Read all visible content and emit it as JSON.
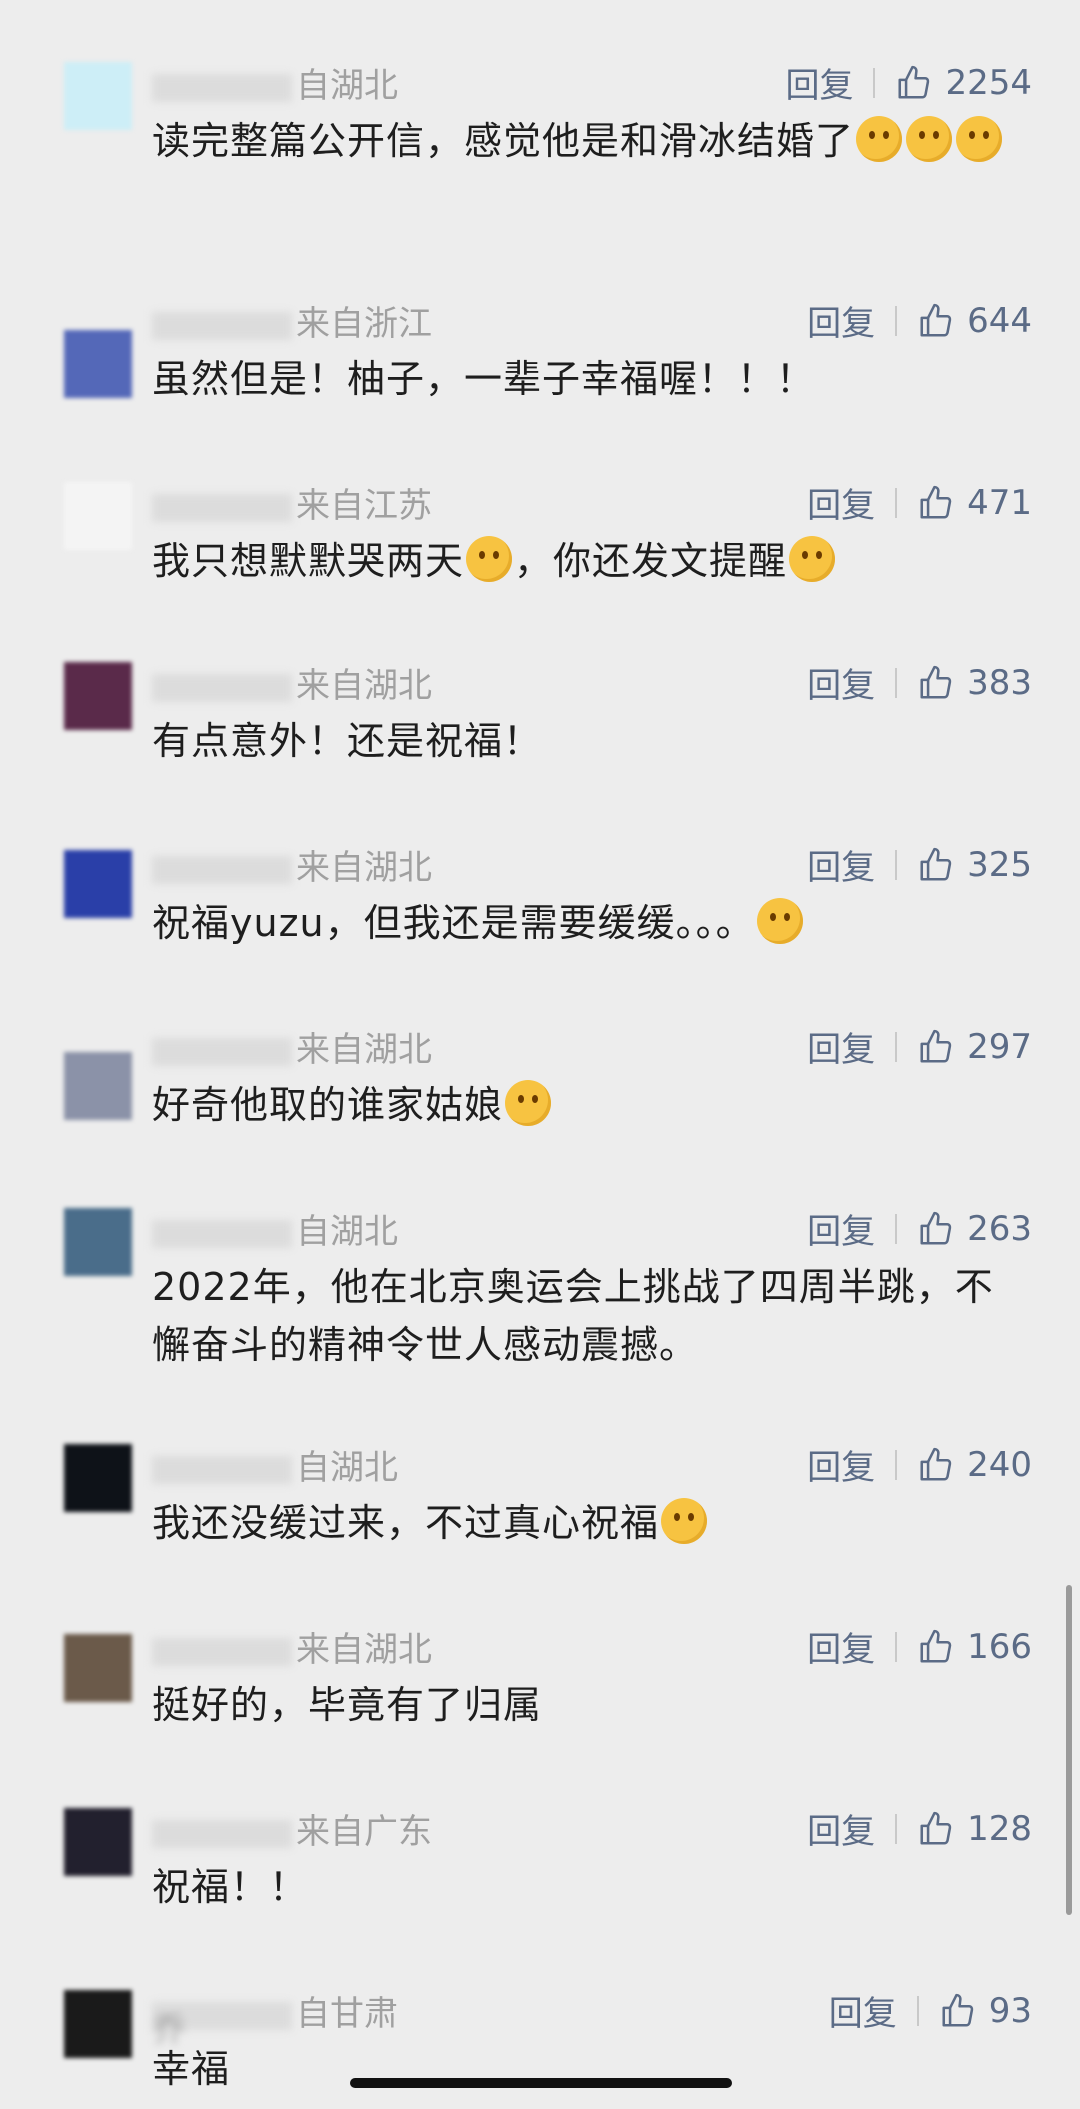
{
  "comments": [
    {
      "author_visible": "",
      "location": "湖北",
      "location_prefix": "自",
      "text": "读完整篇公开信，感觉他是和滑冰结婚了",
      "emoji_count": 3,
      "reply": "回复",
      "likes": "2254",
      "avatar_color": "#cdeef7"
    },
    {
      "author_visible": "",
      "location": "浙江",
      "location_prefix": "来自",
      "text": "虽然但是！柚子，一辈子幸福喔！！！",
      "emoji_count": 0,
      "reply": "回复",
      "likes": "644",
      "avatar_color": "#5468b8"
    },
    {
      "author_visible": "",
      "location": "江苏",
      "location_prefix": "来自",
      "text": "我只想默默哭两天",
      "text_after": "，你还发文提醒",
      "emoji_count": 0,
      "reply": "回复",
      "likes": "471",
      "avatar_color": "#f4f4f4"
    },
    {
      "author_visible": "",
      "location": "湖北",
      "location_prefix": "来自",
      "text": "有点意外！还是祝福！",
      "emoji_count": 0,
      "reply": "回复",
      "likes": "383",
      "avatar_color": "#5a2a4a"
    },
    {
      "author_visible": "",
      "location": "湖北",
      "location_prefix": "来自",
      "text": "祝福yuzu，但我还是需要缓缓。。。",
      "emoji_count": 1,
      "reply": "回复",
      "likes": "325",
      "avatar_color": "#2a3fa8"
    },
    {
      "author_visible": "",
      "location": "湖北",
      "location_prefix": "来自",
      "text": "好奇他取的谁家姑娘",
      "emoji_count": 1,
      "reply": "回复",
      "likes": "297",
      "avatar_color": "#8b92a8"
    },
    {
      "author_visible": "",
      "location": "湖北",
      "location_prefix": "自",
      "text": "2022年，他在北京奥运会上挑战了四周半跳，不懈奋斗的精神令世人感动震撼。",
      "emoji_count": 0,
      "reply": "回复",
      "likes": "263",
      "avatar_color": "#4a6d8a"
    },
    {
      "author_visible": "",
      "location": "湖北",
      "location_prefix": "自",
      "text": "我还没缓过来，不过真心祝福",
      "emoji_count": 1,
      "reply": "回复",
      "likes": "240",
      "avatar_color": "#0e1218"
    },
    {
      "author_visible": "",
      "location": "湖北",
      "location_prefix": "来自",
      "text": "挺好的，毕竟有了归属",
      "emoji_count": 0,
      "reply": "回复",
      "likes": "166",
      "avatar_color": "#6b5a4a"
    },
    {
      "author_visible": "",
      "location": "广东",
      "location_prefix": "来自",
      "text": "祝福！！",
      "emoji_count": 0,
      "reply": "回复",
      "likes": "128",
      "avatar_color": "#22202e"
    },
    {
      "author_visible": "乔",
      "location": "甘肃",
      "location_prefix": "自",
      "text": "幸福",
      "emoji_count": 0,
      "reply": "回复",
      "likes": "93",
      "avatar_color": "#1a1a1a"
    }
  ]
}
